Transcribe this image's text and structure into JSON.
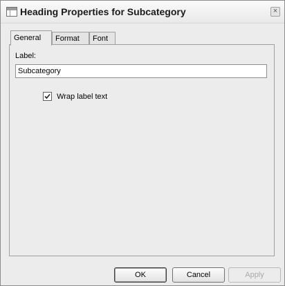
{
  "window": {
    "title": "Heading Properties for Subcategory",
    "close_symbol": "×",
    "icon": "properties-window-icon",
    "close_icon": "close-icon"
  },
  "tabs": [
    {
      "label": "General",
      "active": true
    },
    {
      "label": "Format",
      "active": false
    },
    {
      "label": "Font",
      "active": false
    }
  ],
  "general": {
    "label_caption": "Label:",
    "label_value": "Subcategory",
    "wrap_label_text": {
      "label": "Wrap label text",
      "checked": true,
      "icon": "checkmark-icon"
    }
  },
  "buttons": {
    "ok": "OK",
    "cancel": "Cancel",
    "apply": "Apply",
    "apply_enabled": false
  }
}
